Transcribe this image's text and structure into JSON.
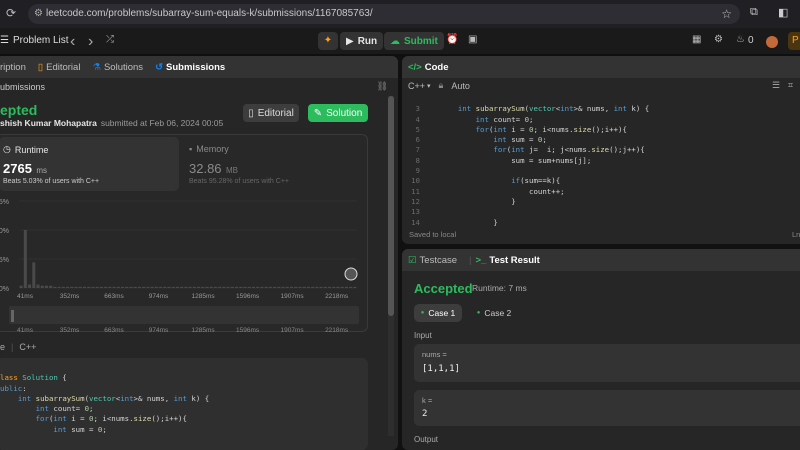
{
  "browser": {
    "url": "leetcode.com/problems/subarray-sum-equals-k/submissions/1167085763/"
  },
  "nav": {
    "problem_list": "Problem List",
    "run": "Run",
    "submit": "Submit",
    "coins": "0"
  },
  "left": {
    "tabs": [
      "ription",
      "Editorial",
      "Solutions",
      "Submissions"
    ],
    "subheader": "ubmissions",
    "status": "epted",
    "author": "shish Kumar Mohapatra",
    "submitted": "submitted at Feb 06, 2024 00:05",
    "editorial_btn": "Editorial",
    "solution_btn": "Solution",
    "runtime_label": "Runtime",
    "runtime_value": "2765",
    "runtime_unit": "ms",
    "runtime_beats": "Beats 5.03% of users with C++",
    "memory_label": "Memory",
    "memory_value": "32.86",
    "memory_unit": "MB",
    "memory_beats": "Beats 95.28% of users with C++",
    "chart_y": [
      "75%",
      "50%",
      "25%",
      "0%"
    ],
    "chart_x": [
      "41ms",
      "352ms",
      "663ms",
      "974ms",
      "1285ms",
      "1596ms",
      "1907ms",
      "2218ms"
    ],
    "lang_left": "e",
    "lang": "C++",
    "code": [
      [
        "cl",
        "lass "
      ],
      [
        "ty",
        "Solution"
      ],
      [
        "",
        "  {"
      ]
    ]
  },
  "right": {
    "code_tab": "Code",
    "lang": "C++",
    "auto": "Auto",
    "saved": "Saved to local",
    "ln_label": "Ln",
    "testcase_tab": "Testcase",
    "testresult_tab": "Test Result",
    "result": "Accepted",
    "runtime": "Runtime: 7 ms",
    "case1": "Case 1",
    "case2": "Case 2",
    "input_label": "Input",
    "nums_label": "nums =",
    "nums_value": "[1,1,1]",
    "k_label": "k =",
    "k_value": "2",
    "output_label": "Output"
  },
  "chart_data": {
    "type": "bar",
    "categories": [
      "41ms",
      "352ms",
      "663ms",
      "974ms",
      "1285ms",
      "1596ms",
      "1907ms",
      "2218ms"
    ],
    "ylim": [
      0,
      75
    ],
    "values": [
      2,
      50,
      3,
      22,
      3,
      2,
      2,
      2,
      1,
      1,
      1,
      1,
      1,
      1,
      1,
      1,
      1,
      1,
      1,
      1,
      1,
      1,
      1,
      1,
      1,
      1,
      1,
      1,
      1,
      1,
      1,
      1,
      1,
      1,
      1,
      1,
      1,
      1,
      1,
      1,
      1,
      1,
      1,
      1,
      1,
      1,
      1,
      1,
      1,
      1,
      1,
      1,
      1,
      1,
      1,
      1,
      1,
      1,
      1,
      1,
      1,
      1,
      1,
      1,
      1,
      1,
      1,
      1,
      1,
      1,
      1,
      1,
      1,
      1,
      1,
      1,
      1,
      1,
      1,
      1
    ]
  },
  "colors": {
    "accent": "#2cbb5d",
    "orange": "#ffa116",
    "blue": "#0a84ff"
  }
}
